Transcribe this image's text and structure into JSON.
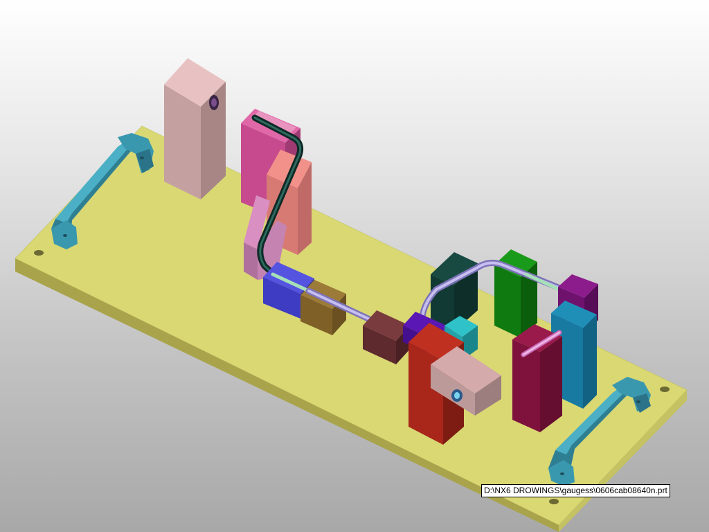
{
  "viewport": {
    "tooltip_path": "D:\\NX6 DROWINGS\\gaugess\\0606cab08640n.prt"
  },
  "colors": {
    "base_plate": "#d9d873",
    "handle": "#3a98ae",
    "tube_light": "#b6aee6",
    "tube_dark": "#1f4740"
  }
}
